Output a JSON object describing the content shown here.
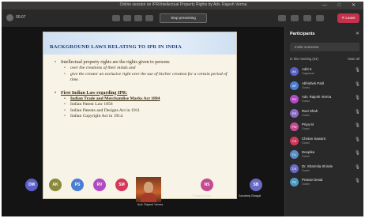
{
  "window": {
    "title": "Online session on IPR/Intellectual Property Rights by Adv. Rajesh Verma",
    "controls": "— □ ✕"
  },
  "toolbar": {
    "timer": "00:07",
    "stop_label": "Stop presenting",
    "leave_label": "✕ Leave"
  },
  "slide": {
    "title": "BACKGROUND LAWS RELATING TO IPR IN INDIA",
    "intro": "Intellectual property rights are the rights given to persons",
    "sub_points": [
      "over the creations of their minds and",
      "give the creator an exclusive right over the use of his/her creation for a certain period of time."
    ],
    "law_heading": "First Indian Law regarding IPR:",
    "laws": [
      "Indian Trade and Merchandise Marks Act 1884",
      "Indian Patent Law 1856",
      "Indian Patents and Designs Act in 1911",
      "Indian Copyright Act in 1914."
    ]
  },
  "participant_tiles": [
    {
      "initials": "DM",
      "color": "#5b5fc7"
    },
    {
      "initials": "AK",
      "color": "#8a8a3a"
    },
    {
      "initials": "PS",
      "color": "#4a7fd4"
    },
    {
      "initials": "RV",
      "color": "#b24ac4"
    },
    {
      "initials": "SM",
      "color": "#d4375a"
    },
    {
      "initials": "NS",
      "color": "#c4498e"
    },
    {
      "initials": "SB",
      "color": "#6a6ac4"
    }
  ],
  "tile_labels": {
    "camera": "Adv. Rajesh Verma",
    "left": "Pooja Suresh",
    "right": "Sandeep Bhagat"
  },
  "panel": {
    "title": "Participants",
    "close": "✕",
    "invite": "Invite someone",
    "section": "In this meeting (34)",
    "mute_all": "Mute all",
    "participants": [
      {
        "initials": "AK",
        "name": "Aditi K",
        "role": "Organizer",
        "color": "#5b5fc7"
      },
      {
        "initials": "AP",
        "name": "Abhishek Patil",
        "role": "Guest",
        "color": "#4a7fd4"
      },
      {
        "initials": "RV",
        "name": "Adv. Rajesh Verma",
        "role": "Guest",
        "color": "#b24ac4"
      },
      {
        "initials": "RS",
        "name": "Ravi Shah",
        "role": "Guest",
        "color": "#8a6ac4"
      },
      {
        "initials": "PM",
        "name": "Priya M",
        "role": "Guest",
        "color": "#c4498e"
      },
      {
        "initials": "CS",
        "name": "Chetan Sawant",
        "role": "Guest",
        "color": "#d4375a"
      },
      {
        "initials": "DJ",
        "name": "Deepika",
        "role": "Guest",
        "color": "#5b8ac4"
      },
      {
        "initials": "DS",
        "name": "Dr. Sharmila Shinde",
        "role": "Guest",
        "color": "#6a6ac4"
      },
      {
        "initials": "PD",
        "name": "Pranav Desai",
        "role": "Guest",
        "color": "#4a9ac4"
      }
    ]
  }
}
